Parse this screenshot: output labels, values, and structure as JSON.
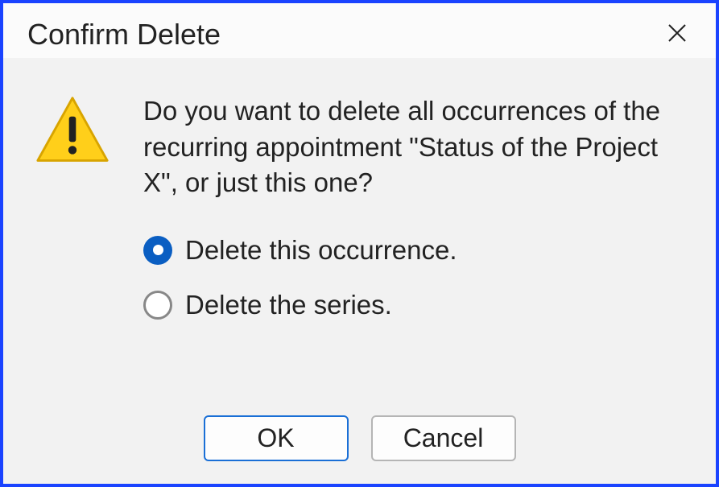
{
  "dialog": {
    "title": "Confirm Delete",
    "message": "Do you want to delete all occurrences of the recurring appointment \"Status of the Project X\", or just this one?",
    "options": [
      {
        "label": "Delete this occurrence.",
        "selected": true
      },
      {
        "label": "Delete the series.",
        "selected": false
      }
    ],
    "buttons": {
      "ok": "OK",
      "cancel": "Cancel"
    }
  }
}
